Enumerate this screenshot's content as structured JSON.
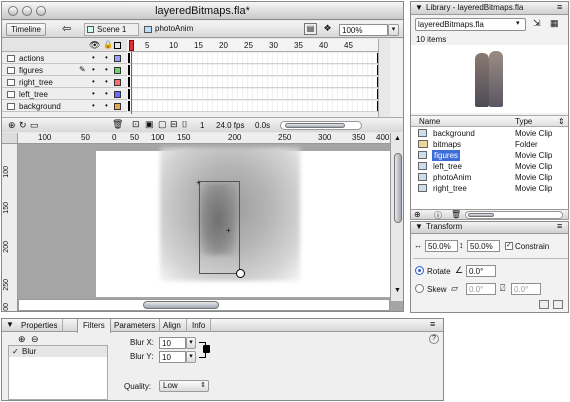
{
  "document_window": {
    "title": "layeredBitmaps.fla*",
    "timeline_button": "Timeline",
    "scene_label": "Scene 1",
    "symbol_label": "photoAnim",
    "zoom_value": "100%",
    "ruler_numbers": [
      "5",
      "10",
      "15",
      "20",
      "25",
      "30",
      "35",
      "40",
      "45"
    ],
    "layers": [
      {
        "name": "actions",
        "color": "#9aa0ff"
      },
      {
        "name": "figures",
        "color": "#6cd46c"
      },
      {
        "name": "right_tree",
        "color": "#ff6c6c"
      },
      {
        "name": "left_tree",
        "color": "#6c6cff"
      },
      {
        "name": "background",
        "color": "#e6a84e"
      }
    ],
    "status": {
      "frame": "1",
      "fps": "24.0 fps",
      "time": "0.0s"
    },
    "stage_ruler_h": [
      "100",
      "50",
      "0",
      "50",
      "100",
      "150",
      "200",
      "250",
      "300",
      "350",
      "400"
    ],
    "stage_ruler_v": [
      "100",
      "150",
      "200",
      "250",
      "300"
    ]
  },
  "library": {
    "title": "Library - layeredBitmaps.fla",
    "dropdown": "layeredBitmaps.fla",
    "count": "10 items",
    "headers": {
      "name": "Name",
      "type": "Type"
    },
    "items": [
      {
        "name": "background",
        "type": "Movie Clip",
        "selected": false
      },
      {
        "name": "bitmaps",
        "type": "Folder",
        "selected": false
      },
      {
        "name": "figures",
        "type": "Movie Clip",
        "selected": true
      },
      {
        "name": "left_tree",
        "type": "Movie Clip",
        "selected": false
      },
      {
        "name": "photoAnim",
        "type": "Movie Clip",
        "selected": false
      },
      {
        "name": "right_tree",
        "type": "Movie Clip",
        "selected": false
      }
    ]
  },
  "transform": {
    "title": "Transform",
    "width": "50.0%",
    "height": "50.0%",
    "constrain": "Constrain",
    "rotate_label": "Rotate",
    "rotate_value": "0.0°",
    "skew_label": "Skew",
    "skew_h": "0.0°",
    "skew_v": "0.0°"
  },
  "properties": {
    "tabs": [
      "Properties",
      "Filters",
      "Parameters",
      "Align",
      "Info"
    ],
    "active_tab": "Filters",
    "filter_item": "Blur",
    "blur_x_label": "Blur X:",
    "blur_x": "10",
    "blur_y_label": "Blur Y:",
    "blur_y": "10",
    "quality_label": "Quality:",
    "quality": "Low"
  },
  "colors": {
    "selection": "#3d6ed8",
    "accent_blue": "#2f5fd0",
    "stage_bg": "#a5a5a5"
  }
}
